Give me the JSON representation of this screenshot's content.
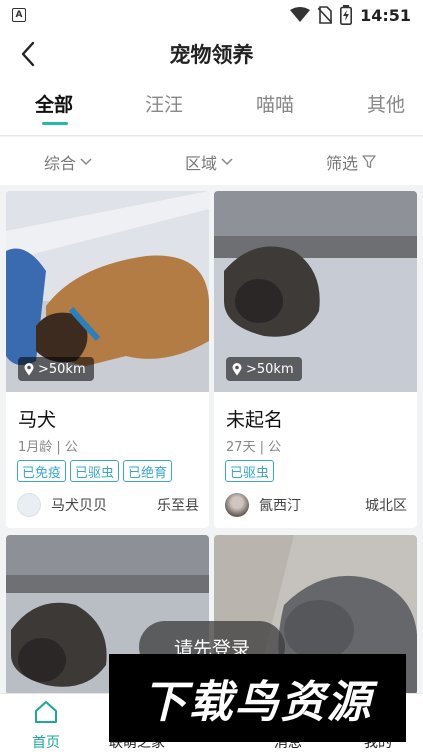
{
  "status_bar": {
    "time": "14:51",
    "app_badge": "A"
  },
  "navbar": {
    "title": "宠物领养"
  },
  "tabs": [
    {
      "label": "全部",
      "active": true
    },
    {
      "label": "汪汪",
      "active": false
    },
    {
      "label": "喵喵",
      "active": false
    },
    {
      "label": "其他",
      "active": false
    }
  ],
  "filters": [
    {
      "label": "综合"
    },
    {
      "label": "区域"
    },
    {
      "label": "筛选"
    }
  ],
  "pets": [
    {
      "name": "马犬",
      "meta": "1月龄 | 公",
      "distance": ">50km",
      "tags": [
        "已免疫",
        "已驱虫",
        "已绝育"
      ],
      "owner": "马犬贝贝",
      "area": "乐至县"
    },
    {
      "name": "未起名",
      "meta": "27天 | 公",
      "distance": ">50km",
      "tags": [
        "已驱虫"
      ],
      "owner": "氤西汀",
      "area": "城北区"
    },
    {
      "name": "",
      "meta": "",
      "distance": "",
      "tags": [],
      "owner": "",
      "area": ""
    },
    {
      "name": "",
      "meta": "",
      "distance": "",
      "tags": [],
      "owner": "",
      "area": ""
    }
  ],
  "toast": "请先登录",
  "bottom_nav": [
    {
      "label": "首页",
      "icon": "home-icon",
      "active": true
    },
    {
      "label": "联萌之家",
      "icon": "community-icon",
      "active": false
    },
    {
      "label": "消息",
      "icon": "message-icon",
      "active": false
    },
    {
      "label": "我的",
      "icon": "profile-icon",
      "active": false
    }
  ],
  "watermark": "下载鸟资源",
  "colors": {
    "accent": "#25b9a6",
    "tag": "#3aa6cf",
    "nav_active": "#1aa899"
  }
}
